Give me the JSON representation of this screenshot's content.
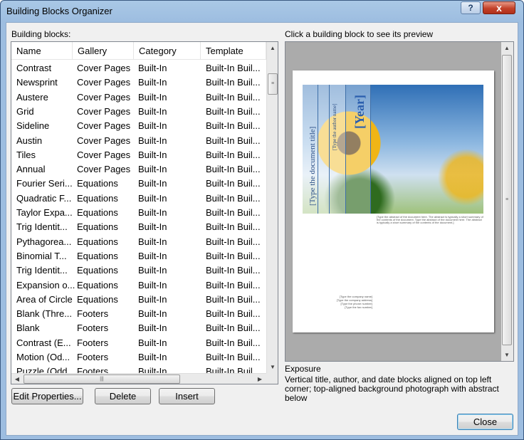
{
  "window": {
    "title": "Building Blocks Organizer",
    "help": "?",
    "close_glyph": "x"
  },
  "left_label": "Building blocks:",
  "right_label": "Click a building block to see its preview",
  "columns": [
    "Name",
    "Gallery",
    "Category",
    "Template"
  ],
  "rows": [
    [
      "Contrast",
      "Cover Pages",
      "Built-In",
      "Built-In Buil..."
    ],
    [
      "Newsprint",
      "Cover Pages",
      "Built-In",
      "Built-In Buil..."
    ],
    [
      "Austere",
      "Cover Pages",
      "Built-In",
      "Built-In Buil..."
    ],
    [
      "Grid",
      "Cover Pages",
      "Built-In",
      "Built-In Buil..."
    ],
    [
      "Sideline",
      "Cover Pages",
      "Built-In",
      "Built-In Buil..."
    ],
    [
      "Austin",
      "Cover Pages",
      "Built-In",
      "Built-In Buil..."
    ],
    [
      "Tiles",
      "Cover Pages",
      "Built-In",
      "Built-In Buil..."
    ],
    [
      "Annual",
      "Cover Pages",
      "Built-In",
      "Built-In Buil..."
    ],
    [
      "Fourier Seri...",
      "Equations",
      "Built-In",
      "Built-In Buil..."
    ],
    [
      "Quadratic F...",
      "Equations",
      "Built-In",
      "Built-In Buil..."
    ],
    [
      "Taylor Expa...",
      "Equations",
      "Built-In",
      "Built-In Buil..."
    ],
    [
      "Trig Identit...",
      "Equations",
      "Built-In",
      "Built-In Buil..."
    ],
    [
      "Pythagorea...",
      "Equations",
      "Built-In",
      "Built-In Buil..."
    ],
    [
      "Binomial T...",
      "Equations",
      "Built-In",
      "Built-In Buil..."
    ],
    [
      "Trig Identit...",
      "Equations",
      "Built-In",
      "Built-In Buil..."
    ],
    [
      "Expansion o...",
      "Equations",
      "Built-In",
      "Built-In Buil..."
    ],
    [
      "Area of Circle",
      "Equations",
      "Built-In",
      "Built-In Buil..."
    ],
    [
      " Blank (Thre...",
      "Footers",
      "Built-In",
      "Built-In Buil..."
    ],
    [
      " Blank",
      "Footers",
      "Built-In",
      "Built-In Buil..."
    ],
    [
      "Contrast (E...",
      "Footers",
      "Built-In",
      "Built-In Buil..."
    ],
    [
      "Motion (Od...",
      "Footers",
      "Built-In",
      "Built-In Buil..."
    ],
    [
      "Puzzle (Odd...",
      "Footers",
      "Built-In",
      "Built-In Buil..."
    ]
  ],
  "buttons": {
    "edit": "Edit Properties...",
    "delete": "Delete",
    "insert": "Insert",
    "close": "Close"
  },
  "preview": {
    "doc_title": "[Type the document title]",
    "author": "[Type the author name]",
    "year": "[Year]",
    "abstract": "[Type the abstract of the document here. The abstract is typically a short summary of the contents of the document. Type the abstract of the document here. The abstract is typically a short summary of the contents of the document.]",
    "company_lines": [
      "[Type the company name]",
      "[Type the company address]",
      "[Type the phone number]",
      "[Type the fax number]"
    ]
  },
  "selected_name": "Exposure",
  "selected_desc": "Vertical title, author, and date blocks aligned on top left corner; top-aligned background photograph with abstract below"
}
